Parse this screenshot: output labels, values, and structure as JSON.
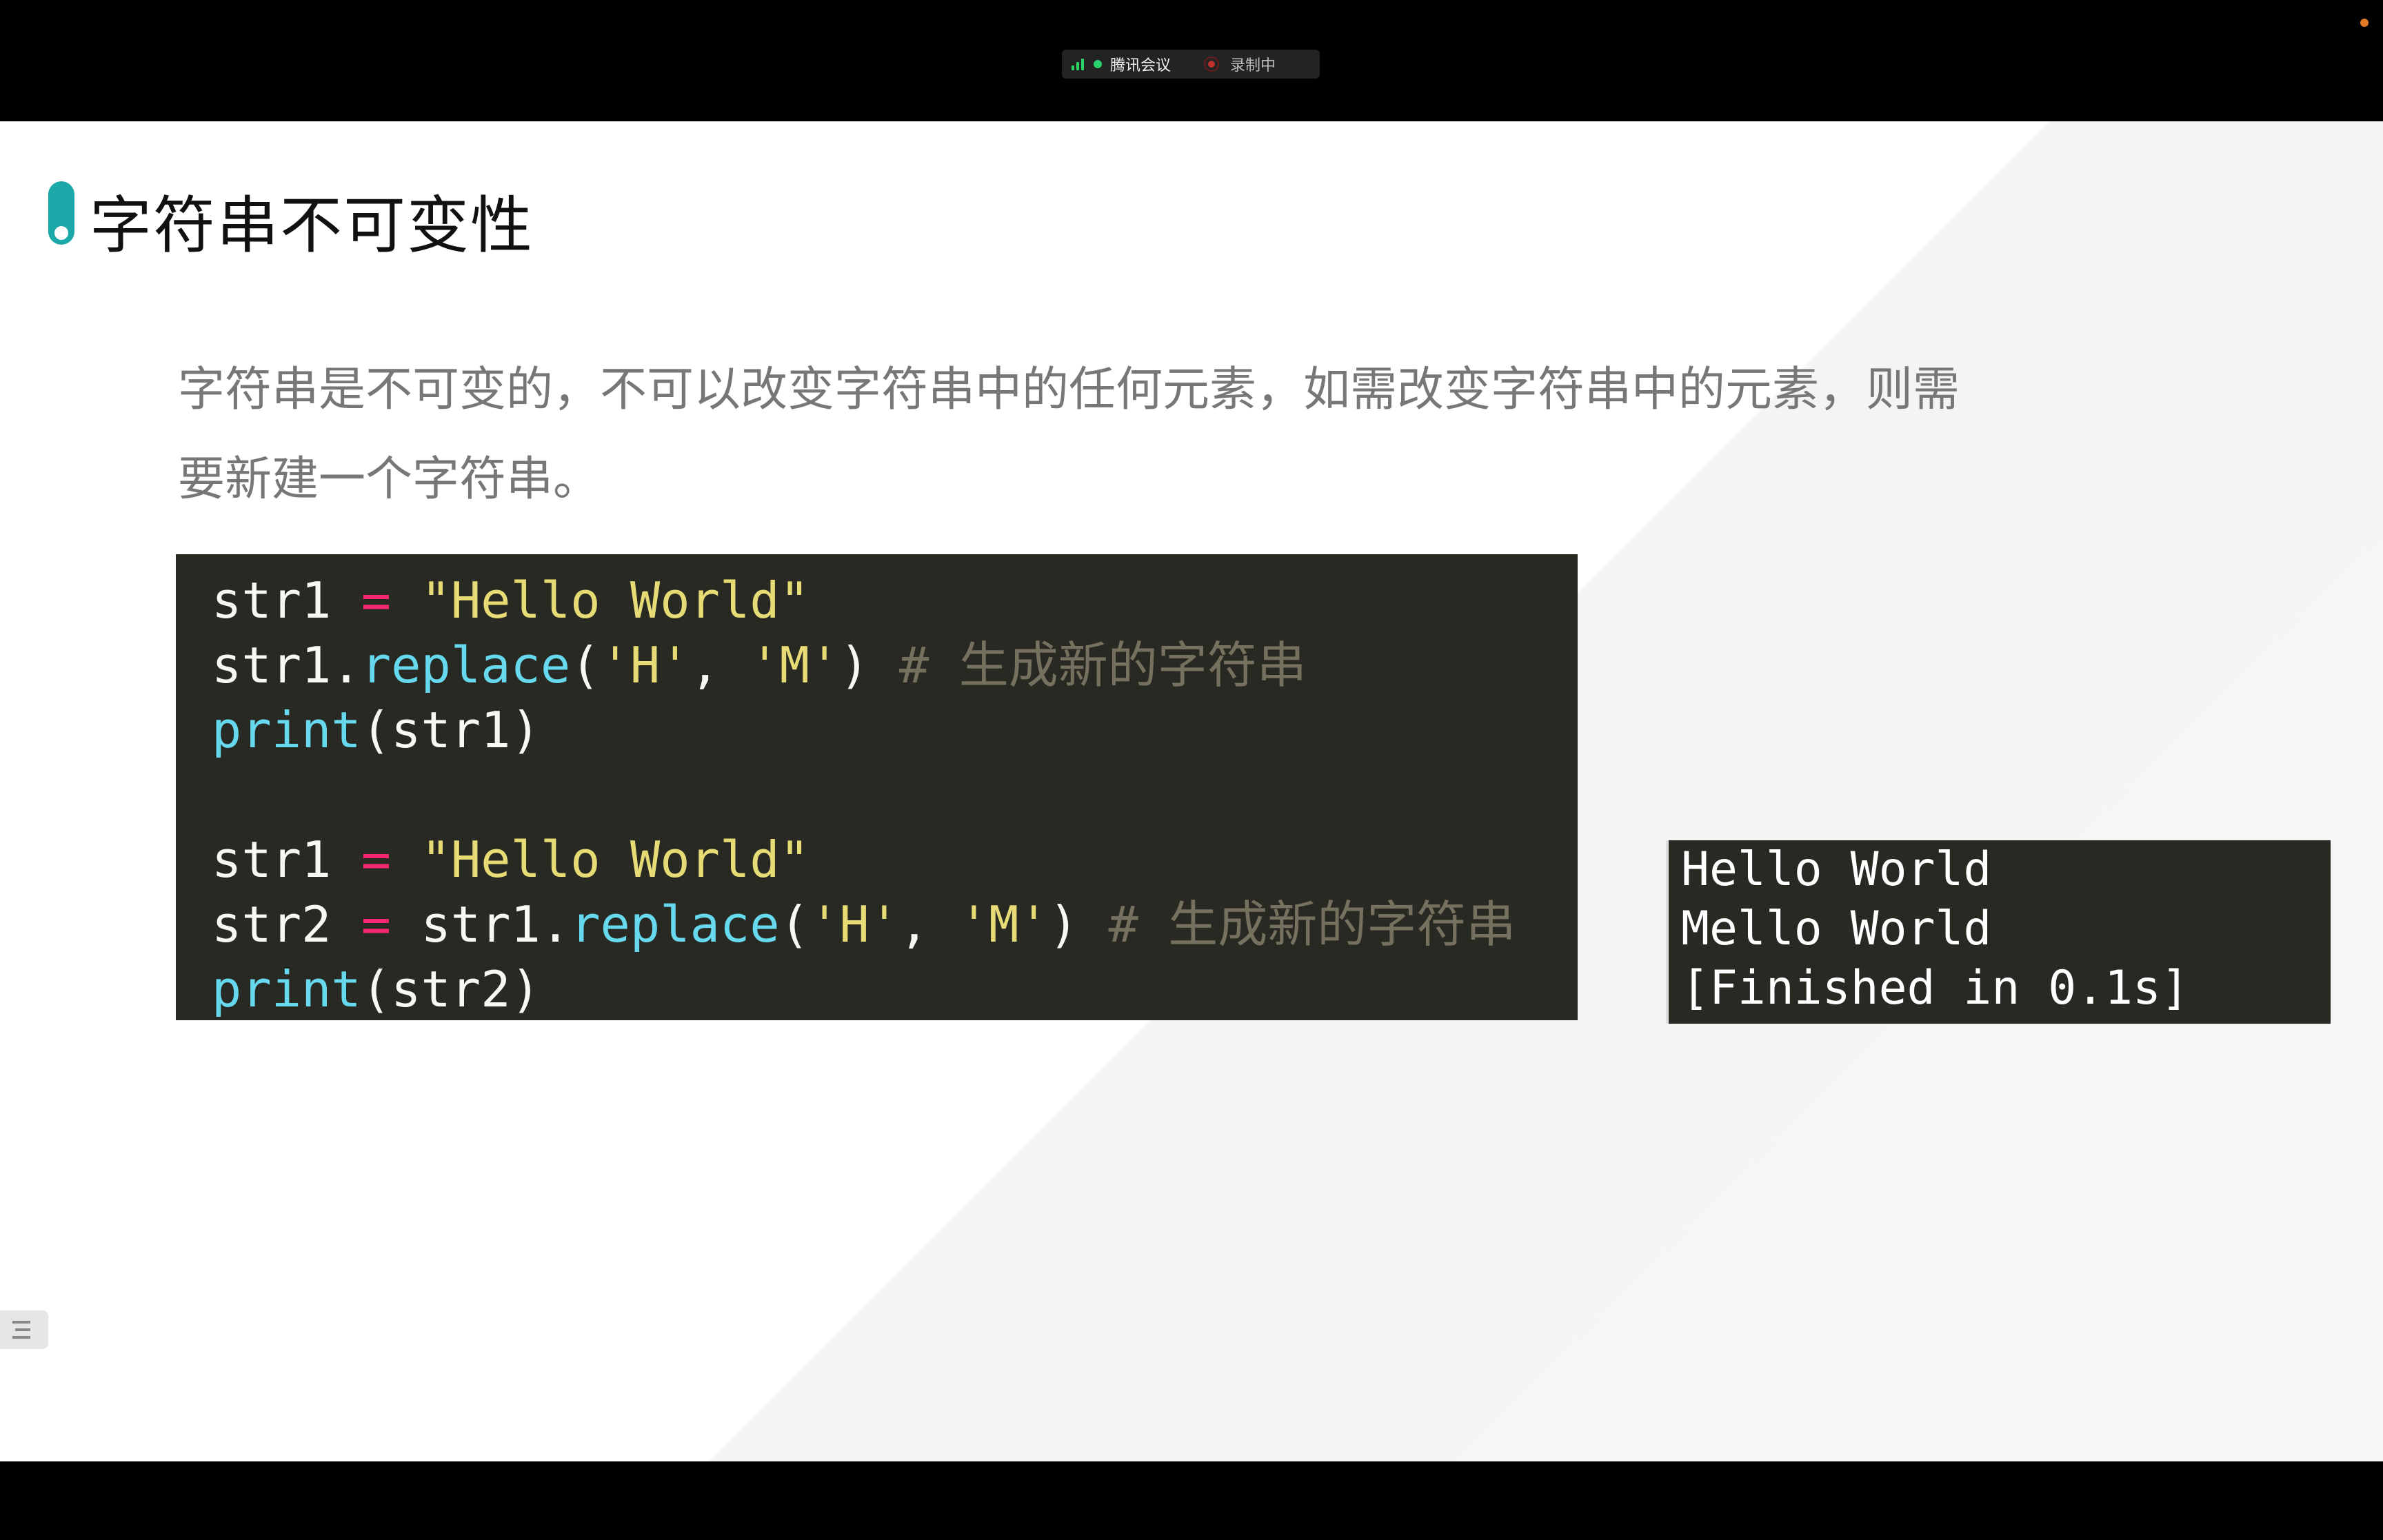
{
  "meeting": {
    "app_label": "腾讯会议",
    "recording_label": "录制中"
  },
  "slide": {
    "title": "字符串不可变性",
    "description_lines": [
      "字符串是不可变的，不可以改变字符串中的任何元素，如需改变字符串中的元素，则需",
      "要新建一个字符串。"
    ]
  },
  "code": {
    "l1": {
      "a": "str1 ",
      "b": "=",
      "c": " ",
      "d": "\"Hello World\""
    },
    "l2": {
      "a": "str1.",
      "b": "replace",
      "c": "(",
      "d": "'H'",
      "e": ", ",
      "f": "'M'",
      "g": ") ",
      "h": "# 生成新的字符串"
    },
    "l3": {
      "a": "print",
      "b": "(str1)"
    },
    "l5": {
      "a": "str1 ",
      "b": "=",
      "c": " ",
      "d": "\"Hello World\""
    },
    "l6": {
      "a": "str2 ",
      "b": "=",
      "c": " str1.",
      "d": "replace",
      "e": "(",
      "f": "'H'",
      "g": ", ",
      "h": "'M'",
      "i": ") ",
      "j": "# 生成新的字符串"
    },
    "l7": {
      "a": "print",
      "b": "(str2)"
    }
  },
  "output": {
    "lines": [
      "Hello World",
      "Mello World",
      "[Finished in 0.1s]"
    ]
  },
  "colors": {
    "accent": "#1aa8a8",
    "code_bg": "#282923",
    "keyword_op": "#f92672",
    "string": "#e6db74",
    "function": "#66d9ef",
    "comment": "#75715e"
  },
  "icons": {
    "signal": "signal-icon",
    "recording": "record-icon",
    "toc": "list-icon"
  }
}
